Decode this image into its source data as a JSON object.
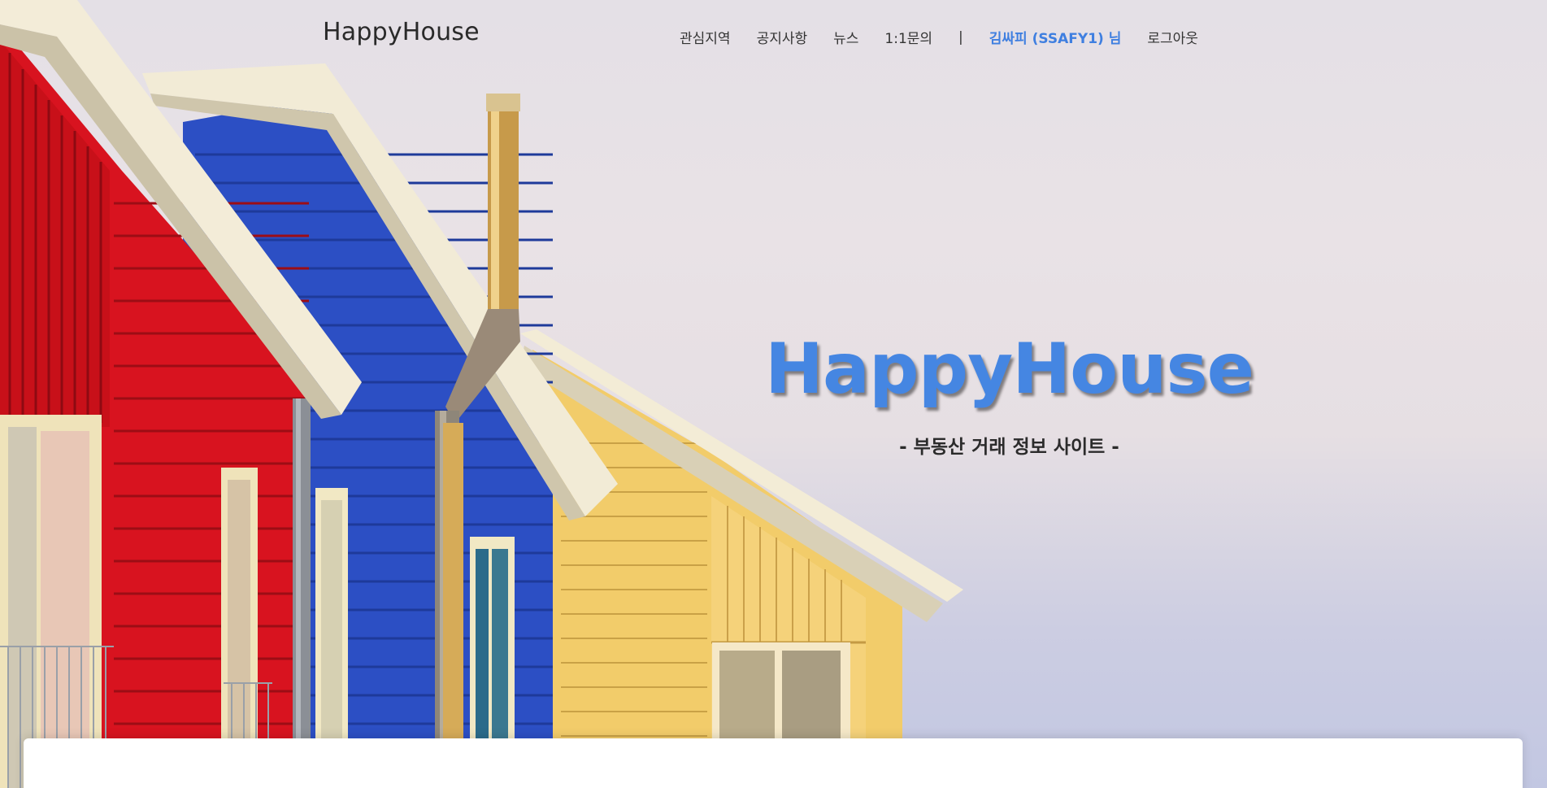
{
  "navbar": {
    "brand": "HappyHouse",
    "links": [
      {
        "label": "관심지역"
      },
      {
        "label": "공지사항"
      },
      {
        "label": "뉴스"
      },
      {
        "label": "1:1문의"
      }
    ],
    "separator": "|",
    "user_label": "김싸피 (SSAFY1) 님",
    "logout_label": "로그아웃"
  },
  "hero": {
    "title": "HappyHouse",
    "subtitle": "- 부동산 거래 정보 사이트 -",
    "title_color": "#4586e2"
  },
  "colors": {
    "accent": "#3f7fe0",
    "house_red": "#d8131f",
    "house_blue": "#2c4fc4",
    "house_yellow": "#f2cc6a"
  }
}
